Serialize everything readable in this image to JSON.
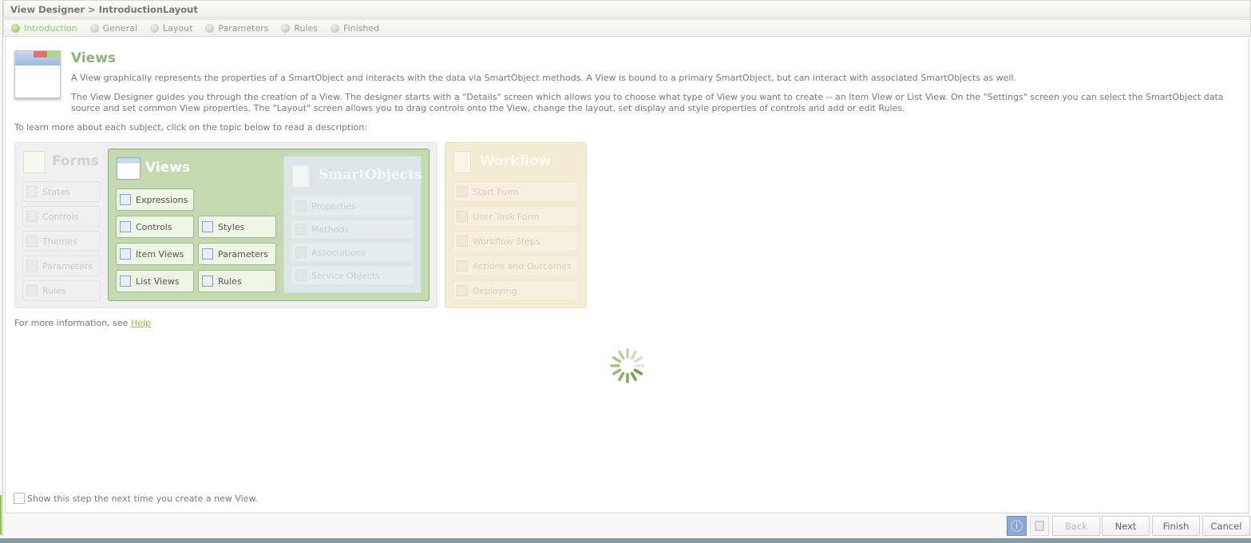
{
  "title": "View Designer > IntroductionLayout",
  "steps": [
    {
      "label": "Introduction",
      "active": true
    },
    {
      "label": "General"
    },
    {
      "label": "Layout"
    },
    {
      "label": "Parameters"
    },
    {
      "label": "Rules"
    },
    {
      "label": "Finished"
    }
  ],
  "intro": {
    "heading": "Views",
    "p1": "A View graphically represents the properties of a SmartObject and interacts with the data via SmartObject methods. A View is bound to a primary SmartObject, but can interact with associated SmartObjects as well.",
    "p2": "The View Designer guides you through the creation of a View. The designer starts with a \"Details\" screen which allows you to choose what type of View you want to create -- an Item View or List View. On the \"Settings\" screen you can select the SmartObject data source and set common View properties. The \"Layout\" screen allows you to drag controls onto the View, change the layout, set display and style properties of controls and add or edit Rules.",
    "learn": "To learn more about each subject, click on the topic below to read a description:"
  },
  "forms": {
    "title": "Forms",
    "items": [
      "States",
      "Controls",
      "Themes",
      "Parameters",
      "Rules"
    ]
  },
  "views": {
    "title": "Views",
    "items": [
      "Expressions",
      "Controls",
      "Styles",
      "Item Views",
      "Parameters",
      "List Views",
      "Rules"
    ]
  },
  "smartobjects": {
    "title": "SmartObjects",
    "items": [
      "Properties",
      "Methods",
      "Associations",
      "Service Objects"
    ]
  },
  "workflow": {
    "title": "Workflow",
    "items": [
      "Start Form",
      "User Task Form",
      "Workflow Steps",
      "Actions and Outcomes",
      "Deploying"
    ]
  },
  "more_info": "For more information, see ",
  "help_link": "Help",
  "show_step": "Show this step the next time you create a new View.",
  "buttons": {
    "back": "Back",
    "next": "Next",
    "finish": "Finish",
    "cancel": "Cancel"
  },
  "colors": {
    "accent": "#8cc63f",
    "views_bg": "#c5d9b0"
  }
}
